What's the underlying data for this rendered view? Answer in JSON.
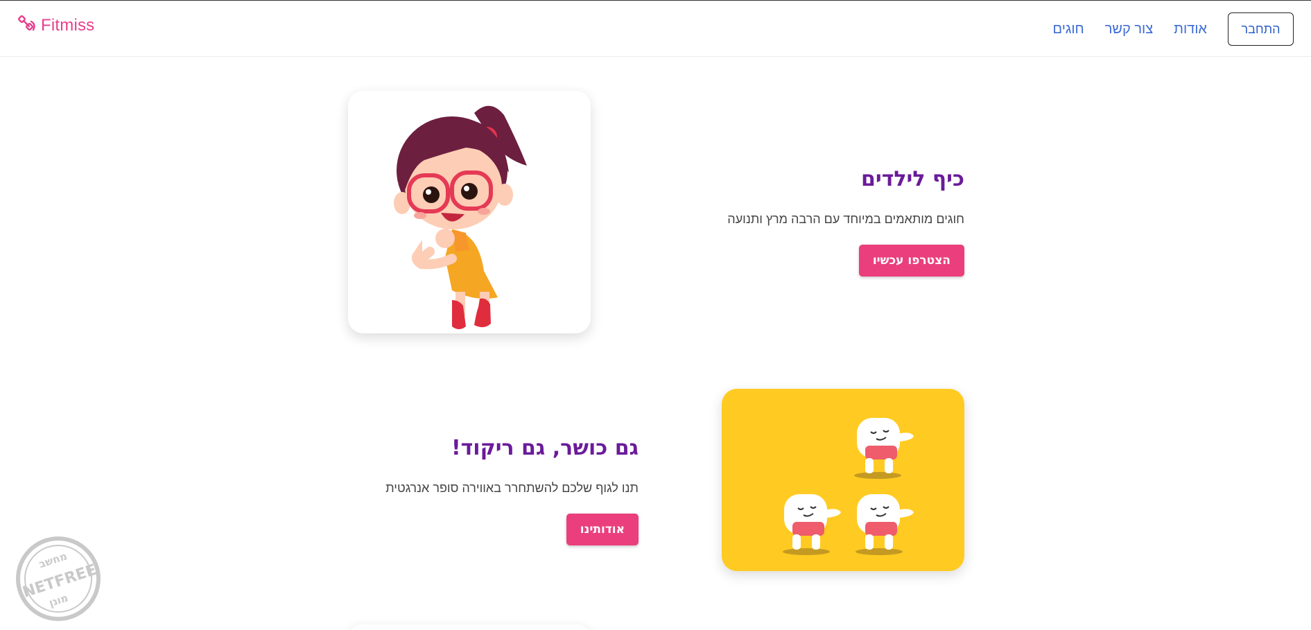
{
  "navbar": {
    "brand": "Fitmiss",
    "links": [
      "חוגים",
      "צור קשר",
      "אודות"
    ],
    "login_label": "התחבר"
  },
  "features": [
    {
      "title": "כיף לילדים",
      "text": "חוגים מותאמים במיוחד עם הרבה מרץ ותנועה",
      "button": "הצטרפו עכשיו"
    },
    {
      "title": "גם כושר, גם ריקוד!",
      "text": "תנו לגוף שלכם להשתחרר באווירה סופר אנרגטית",
      "button": "אודותינו"
    }
  ],
  "watermark": {
    "top": "מחשב",
    "middle": "NETFREE",
    "bottom": "מוגן"
  },
  "colors": {
    "brand": "#e83e8c",
    "nav_link": "#3a6ad6",
    "title": "#6a1b9a",
    "cta": "#ea3f7c",
    "card_yellow": "#ffcb22"
  }
}
